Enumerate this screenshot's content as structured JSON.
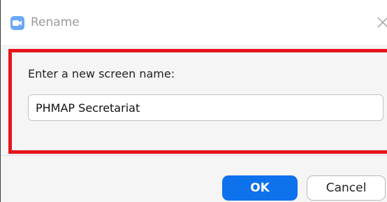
{
  "window": {
    "title": "Rename",
    "app_icon": "zoom-camera-icon",
    "close_icon": "close-icon"
  },
  "form": {
    "prompt_label": "Enter a new screen name:",
    "name_value": "PHMAP Secretariat"
  },
  "buttons": {
    "ok_label": "OK",
    "cancel_label": "Cancel"
  },
  "colors": {
    "accent": "#0e72ed",
    "highlight_border": "#e6141b",
    "app_icon": "#6aa8f7"
  }
}
